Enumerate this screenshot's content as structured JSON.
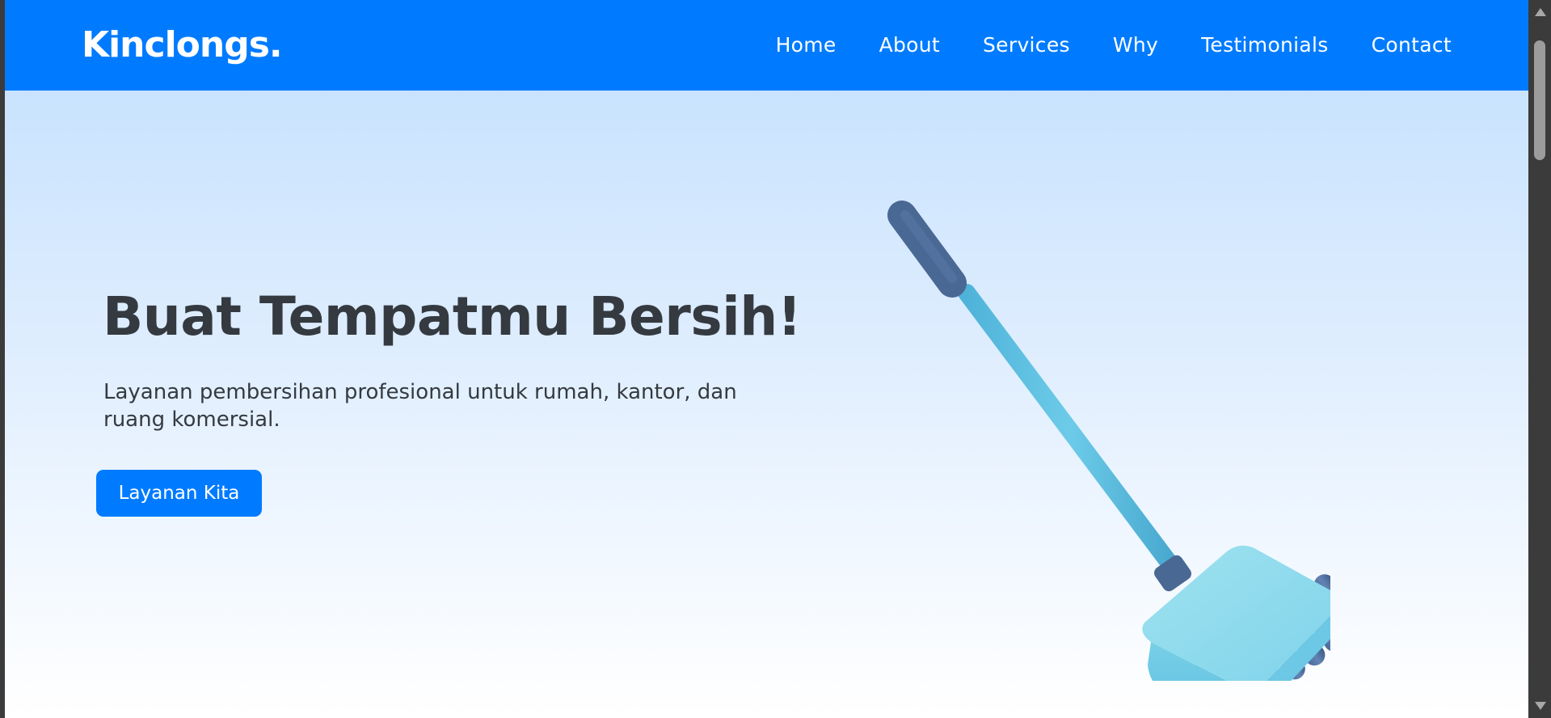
{
  "navbar": {
    "brand": "Kinclongs.",
    "links": [
      {
        "label": "Home"
      },
      {
        "label": "About"
      },
      {
        "label": "Services"
      },
      {
        "label": "Why"
      },
      {
        "label": "Testimonials"
      },
      {
        "label": "Contact"
      }
    ],
    "background_color": "#007bff"
  },
  "hero": {
    "title": "Buat Tempatmu Bersih!",
    "subtitle": "Layanan pembersihan profesional untuk rumah, kantor, dan ruang komersial.",
    "cta_label": "Layanan Kita",
    "illustration": "broom-icon"
  },
  "colors": {
    "accent": "#007bff",
    "text_dark": "#343a40",
    "broom_handle": "#5bc0de",
    "broom_grip": "#4a6894"
  }
}
